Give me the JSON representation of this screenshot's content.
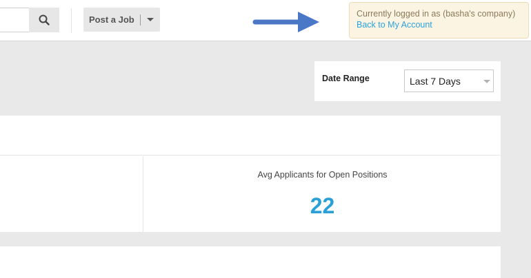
{
  "header": {
    "search": {
      "placeholder": "",
      "value": ""
    },
    "search_icon": "search-icon",
    "post_job": {
      "label": "Post a Job",
      "caret_icon": "chevron-down-icon"
    },
    "arrow_icon": "arrow-right-icon",
    "arrow_color": "#4a78c6"
  },
  "login_notice": {
    "text": "Currently logged in as (basha's company)",
    "link": "Back to My Account",
    "bg_color": "#fcf4e3",
    "link_color": "#29a2dd"
  },
  "date_range": {
    "label": "Date Range",
    "selected": "Last 7 Days"
  },
  "stats": {
    "items": [
      {
        "label": "Avg Applicants for Open Positions",
        "value": "22"
      }
    ],
    "value_color": "#2a9fd8"
  }
}
